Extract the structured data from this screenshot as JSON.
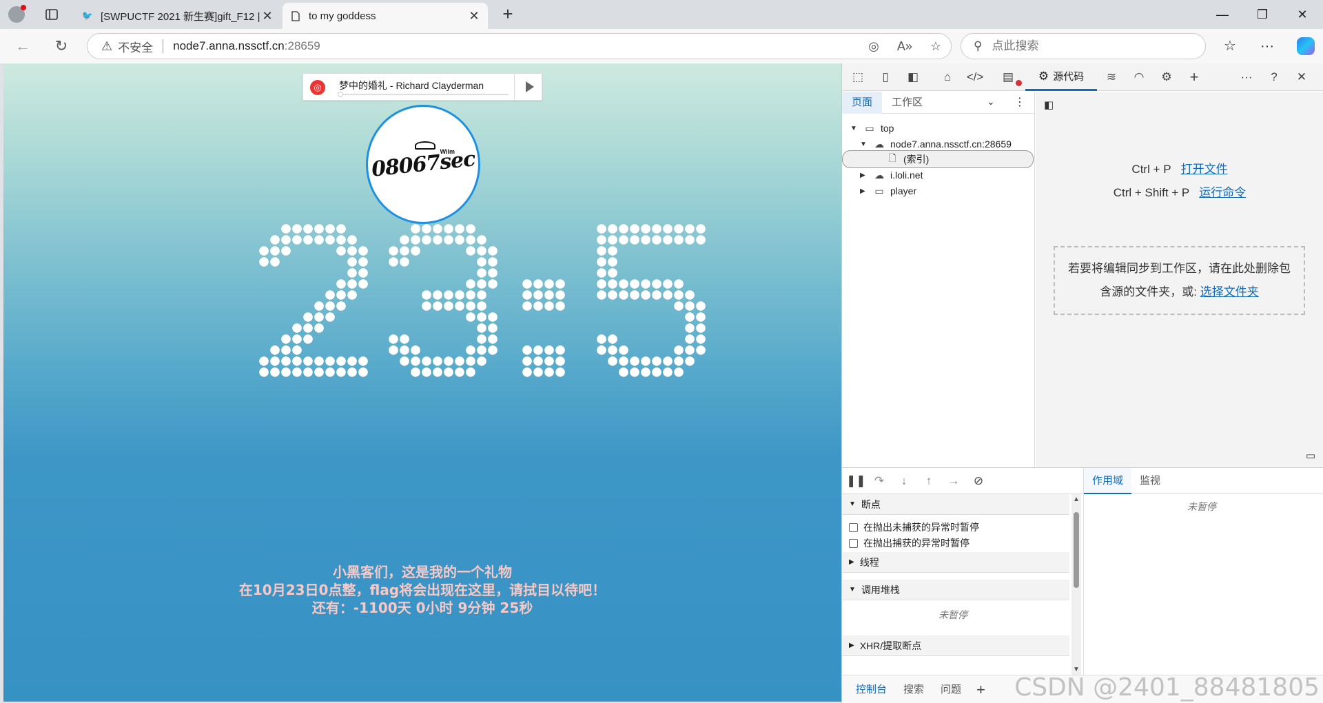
{
  "browser": {
    "tabs": [
      {
        "label": "[SWPUCTF 2021 新生赛]gift_F12 |",
        "favicon": "bird-icon"
      },
      {
        "label": "to my goddess",
        "favicon": "page-icon"
      }
    ],
    "security_label": "不安全",
    "url_host": "node7.anna.nssctf.cn",
    "url_port": ":28659",
    "search_placeholder": "点此搜索"
  },
  "page": {
    "music_player": {
      "song": "梦中的婚礼 - Richard Clayderman"
    },
    "logo": {
      "text": "08067sec",
      "small_text": "Wilm"
    },
    "clock": {
      "digits": [
        "2",
        "3",
        ":",
        "5"
      ],
      "dot_color": "#ffffff"
    },
    "message": {
      "line1": "小黑客们，这是我的一个礼物",
      "line2": "在10月23日0点整，flag将会出现在这里，请拭目以待吧！",
      "line3": "还有：-1100天 0小时 9分钟 25秒"
    }
  },
  "devtools": {
    "sources_tab": "源代码",
    "nav_tabs": [
      "页面",
      "工作区"
    ],
    "tree": [
      {
        "label": "top"
      },
      {
        "label": "node7.anna.nssctf.cn:28659"
      },
      {
        "label": "(索引)"
      },
      {
        "label": "i.loli.net"
      },
      {
        "label": "player"
      }
    ],
    "shortcuts": [
      {
        "keys": "Ctrl + P",
        "action": "打开文件"
      },
      {
        "keys": "Ctrl + Shift + P",
        "action": "运行命令"
      }
    ],
    "workspace_hint": {
      "text": "若要将编辑同步到工作区，请在此处删除包含源的文件夹，或:",
      "link": "选择文件夹"
    },
    "debugger": {
      "sections": {
        "breakpoints": "断点",
        "threads": "线程",
        "callstack": "调用堆栈",
        "xhr": "XHR/提取断点"
      },
      "checkboxes": [
        "在抛出未捕获的异常时暂停",
        "在抛出捕获的异常时暂停"
      ],
      "not_paused": "未暂停",
      "right_tabs": [
        "作用域",
        "监视"
      ]
    },
    "drawer_tabs": [
      "控制台",
      "搜索",
      "问题"
    ]
  },
  "watermark": "CSDN @2401_88481805",
  "colors": {
    "accent": "#0f6cbd",
    "page_gradient_top": "#cfeadf",
    "page_gradient_bottom": "#3792c4",
    "message": "#f6c9c6"
  }
}
